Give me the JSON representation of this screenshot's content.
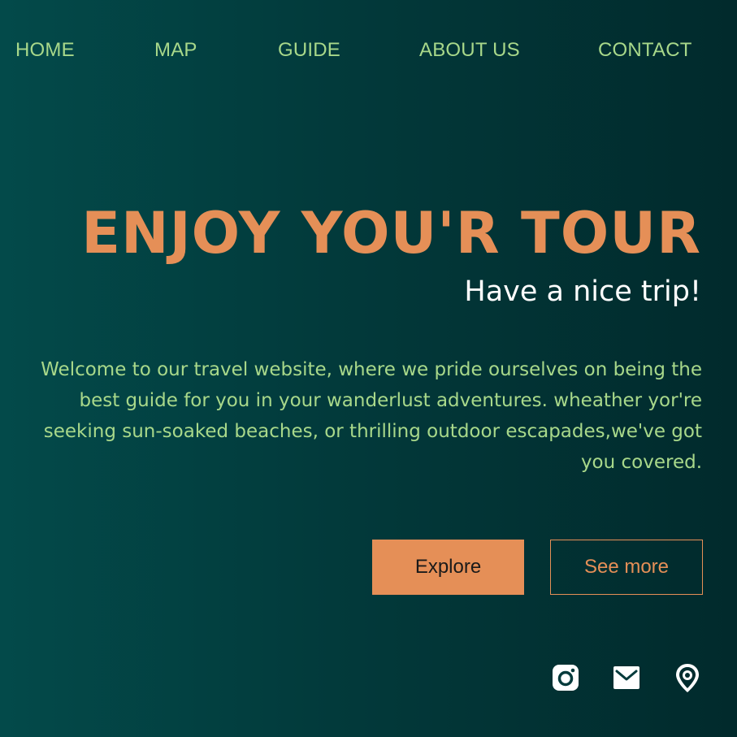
{
  "nav": {
    "items": [
      {
        "label": "HOME"
      },
      {
        "label": "MAP"
      },
      {
        "label": "GUIDE"
      },
      {
        "label": "ABOUT US"
      },
      {
        "label": "CONTACT"
      }
    ]
  },
  "hero": {
    "title": "ENJOY YOU'R TOUR",
    "subtitle": "Have a nice trip!",
    "text": "Welcome to our travel website, where we pride ourselves on being the best guide for you in your wanderlust adventures. wheather yor're seeking sun-soaked beaches, or thrilling outdoor escapades,we've got you covered."
  },
  "buttons": {
    "explore": "Explore",
    "see_more": "See more"
  },
  "social": {
    "icons": [
      "instagram-icon",
      "mail-icon",
      "location-pin-icon"
    ]
  },
  "colors": {
    "accent": "#e58f57",
    "nav_text": "#a8d88a",
    "background_start": "#034a4a",
    "background_end": "#012a2c"
  }
}
